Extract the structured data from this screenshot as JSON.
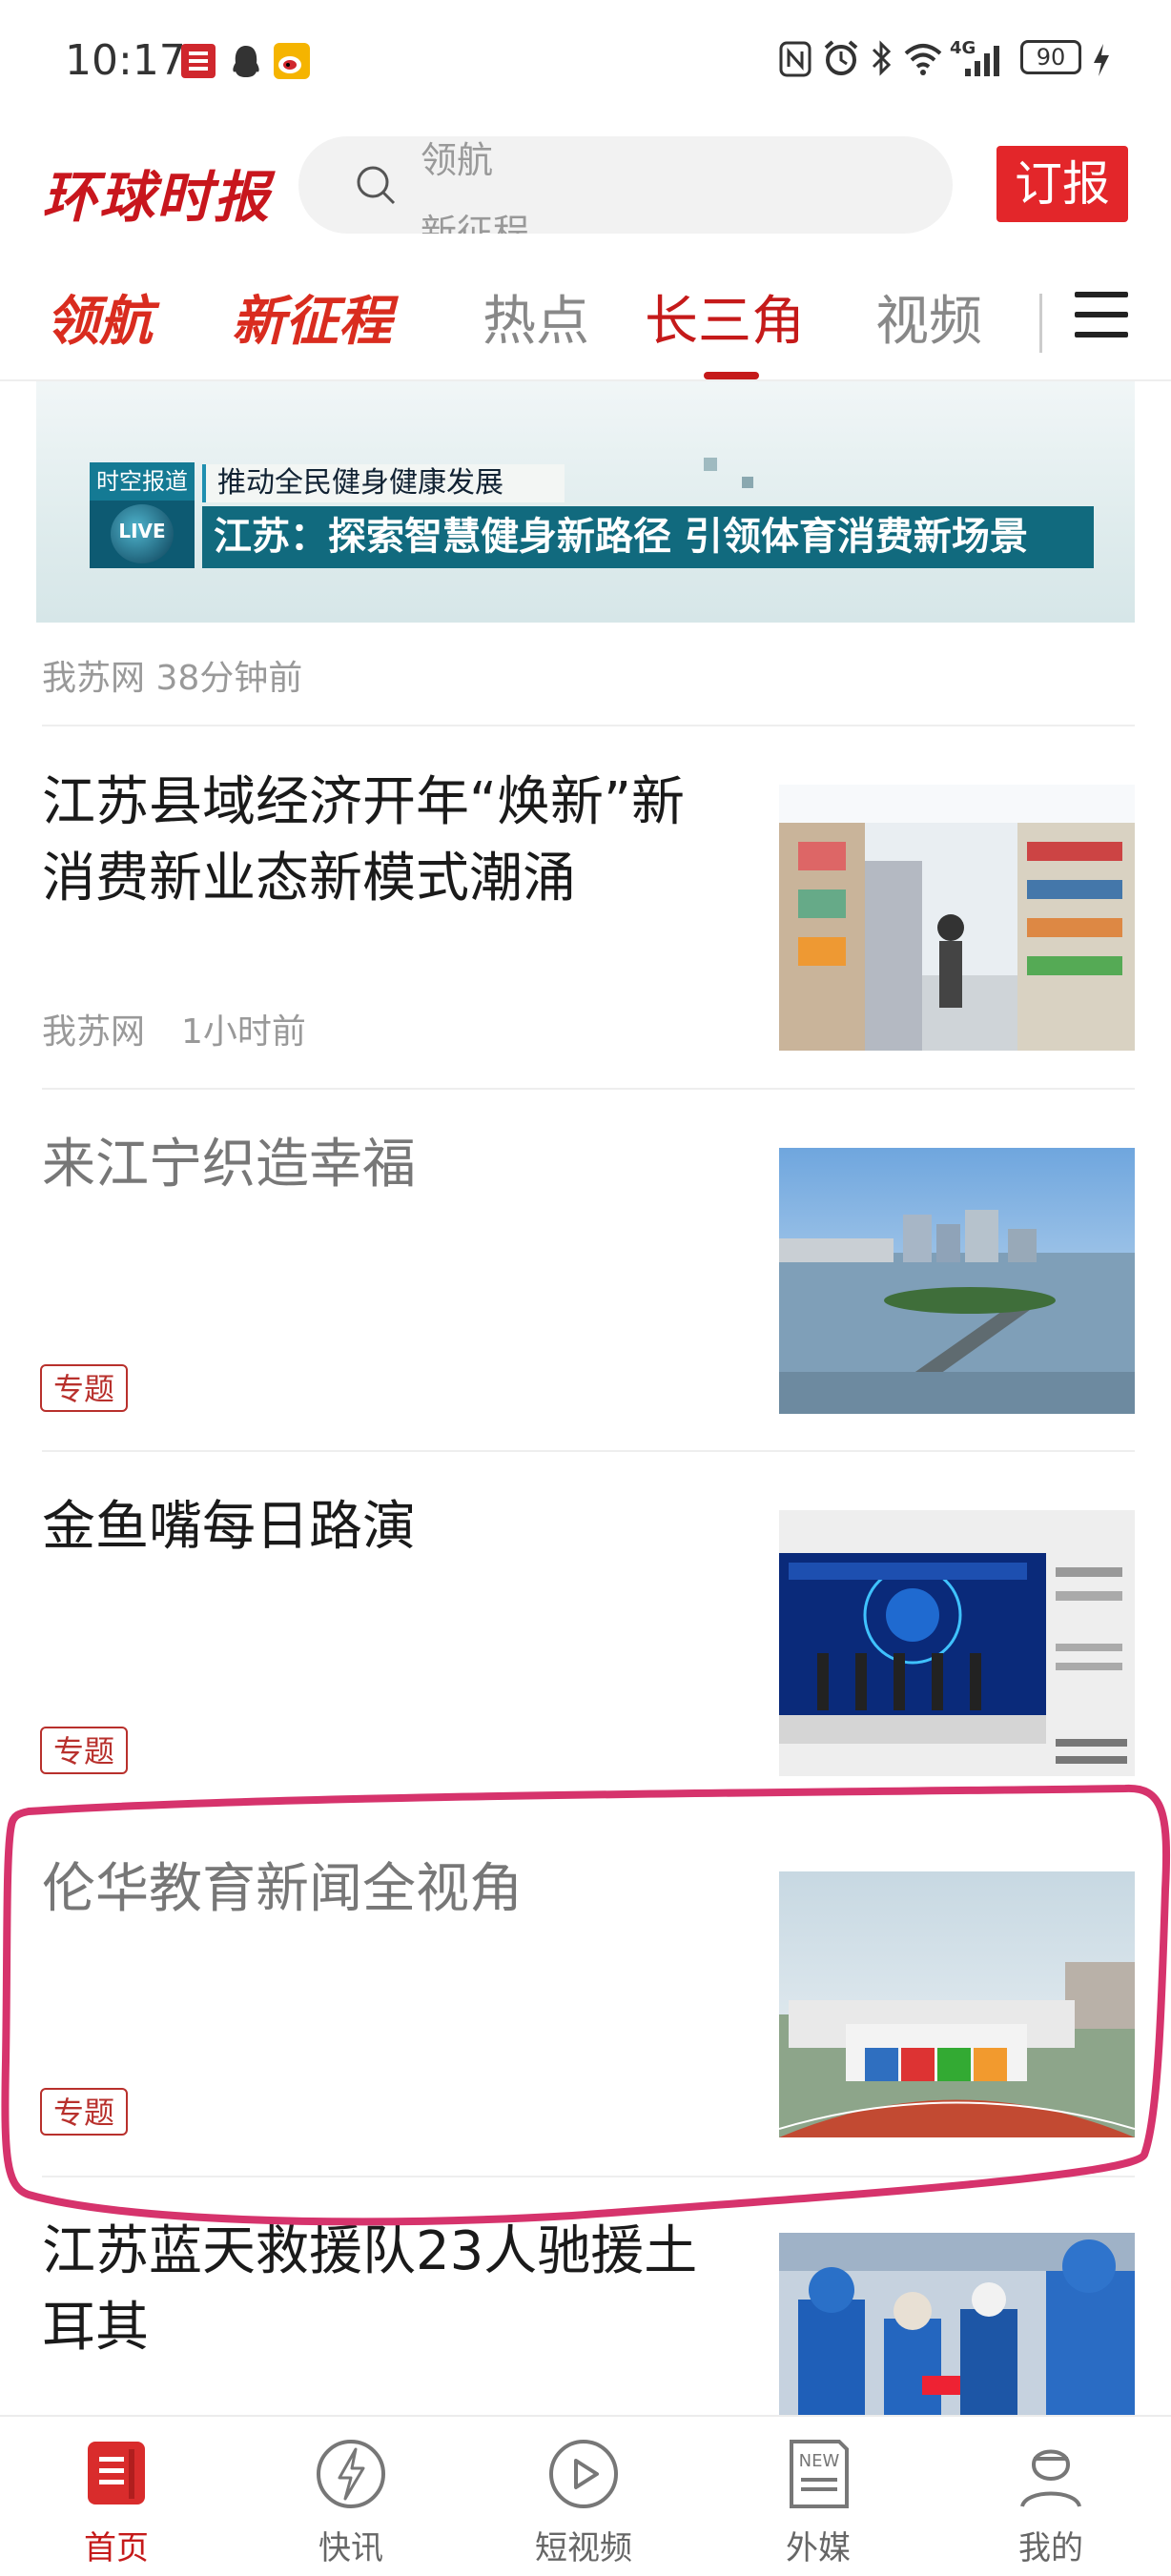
{
  "status_bar": {
    "time": "10:17",
    "battery": "90",
    "network": "4G"
  },
  "header": {
    "logo_text": "环球时报",
    "search_hints": [
      "领航",
      "新征程"
    ],
    "subscribe_label": "订报"
  },
  "tabs": [
    {
      "label": "领航"
    },
    {
      "label": "新征程"
    },
    {
      "label": "热点"
    },
    {
      "label": "长三角"
    },
    {
      "label": "视频"
    }
  ],
  "banner": {
    "badge_top": "时空报道",
    "badge_live": "LIVE",
    "subtitle": "推动全民健身健康发展",
    "headline": "江苏：探索智慧健身新路径 引领体育消费新场景"
  },
  "banner_meta": "我苏网 38分钟前",
  "articles": [
    {
      "title": "江苏县域经济开年“焕新”新消费新业态新模式潮涌",
      "source": "我苏网",
      "time": "1小时前"
    },
    {
      "title": "来江宁织造幸福",
      "badge": "专题"
    },
    {
      "title": "金鱼嘴每日路演",
      "badge": "专题"
    },
    {
      "title": "伦华教育新闻全视角",
      "badge": "专题"
    },
    {
      "title": "江苏蓝天救援队23人驰援土耳其"
    }
  ],
  "bottom_nav": [
    {
      "label": "首页",
      "icon": "home-icon"
    },
    {
      "label": "快讯",
      "icon": "flash-icon"
    },
    {
      "label": "短视频",
      "icon": "play-icon"
    },
    {
      "label": "外媒",
      "icon": "newspaper-icon"
    },
    {
      "label": "我的",
      "icon": "profile-icon"
    }
  ],
  "colors": {
    "accent": "#c51a1a",
    "brand_red": "#e3262a",
    "annotation": "#d6336c"
  }
}
